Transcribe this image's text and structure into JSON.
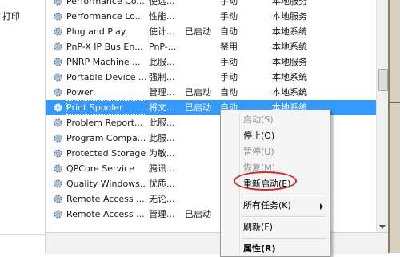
{
  "left_pane": {
    "fragment": "打印"
  },
  "services": [
    {
      "name": "Performance Co...",
      "desc": "使远...",
      "status": "",
      "startup": "手动",
      "logon": "本地服务"
    },
    {
      "name": "Performance Lo...",
      "desc": "性能...",
      "status": "",
      "startup": "手动",
      "logon": "本地服务"
    },
    {
      "name": "Plug and Play",
      "desc": "使计...",
      "status": "已启动",
      "startup": "自动",
      "logon": "本地系统"
    },
    {
      "name": "PnP-X IP Bus En...",
      "desc": "PnP-...",
      "status": "",
      "startup": "禁用",
      "logon": "本地系统"
    },
    {
      "name": "PNRP Machine ...",
      "desc": "此服...",
      "status": "",
      "startup": "手动",
      "logon": "本地服务"
    },
    {
      "name": "Portable Device ...",
      "desc": "强制...",
      "status": "",
      "startup": "手动",
      "logon": "本地系统"
    },
    {
      "name": "Power",
      "desc": "管理...",
      "status": "已启动",
      "startup": "自动",
      "logon": "本地系统"
    },
    {
      "name": "Print Spooler",
      "desc": "将文...",
      "status": "已启动",
      "startup": "自动",
      "logon": "本地系统",
      "selected": true
    },
    {
      "name": "Problem Report...",
      "desc": "此服...",
      "status": "",
      "startup": "",
      "logon": ""
    },
    {
      "name": "Program Compa...",
      "desc": "此服...",
      "status": "",
      "startup": "",
      "logon": ""
    },
    {
      "name": "Protected Storage",
      "desc": "为敏...",
      "status": "",
      "startup": "",
      "logon": ""
    },
    {
      "name": "QPCore Service",
      "desc": "腾讯...",
      "status": "",
      "startup": "",
      "logon": ""
    },
    {
      "name": "Quality Windows...",
      "desc": "优质...",
      "status": "",
      "startup": "",
      "logon": ""
    },
    {
      "name": "Remote Access ...",
      "desc": "无论...",
      "status": "",
      "startup": "",
      "logon": ""
    },
    {
      "name": "Remote Access ...",
      "desc": "管理...",
      "status": "已启动",
      "startup": "",
      "logon": ""
    }
  ],
  "context_menu": {
    "start": "启动(S)",
    "stop": "停止(O)",
    "pause": "暂停(U)",
    "resume": "恢复(M)",
    "restart": "重新启动(E)",
    "all_tasks": "所有任务(K)",
    "refresh": "刷新(F)",
    "properties": "属性(R)"
  },
  "colors": {
    "selection": "#3399ff",
    "annotation_ring": "#cc2a2a",
    "gear_icon": "#6c8fb3"
  },
  "icons": {
    "service": "gear-icon",
    "submenu": "chevron-right-icon"
  }
}
